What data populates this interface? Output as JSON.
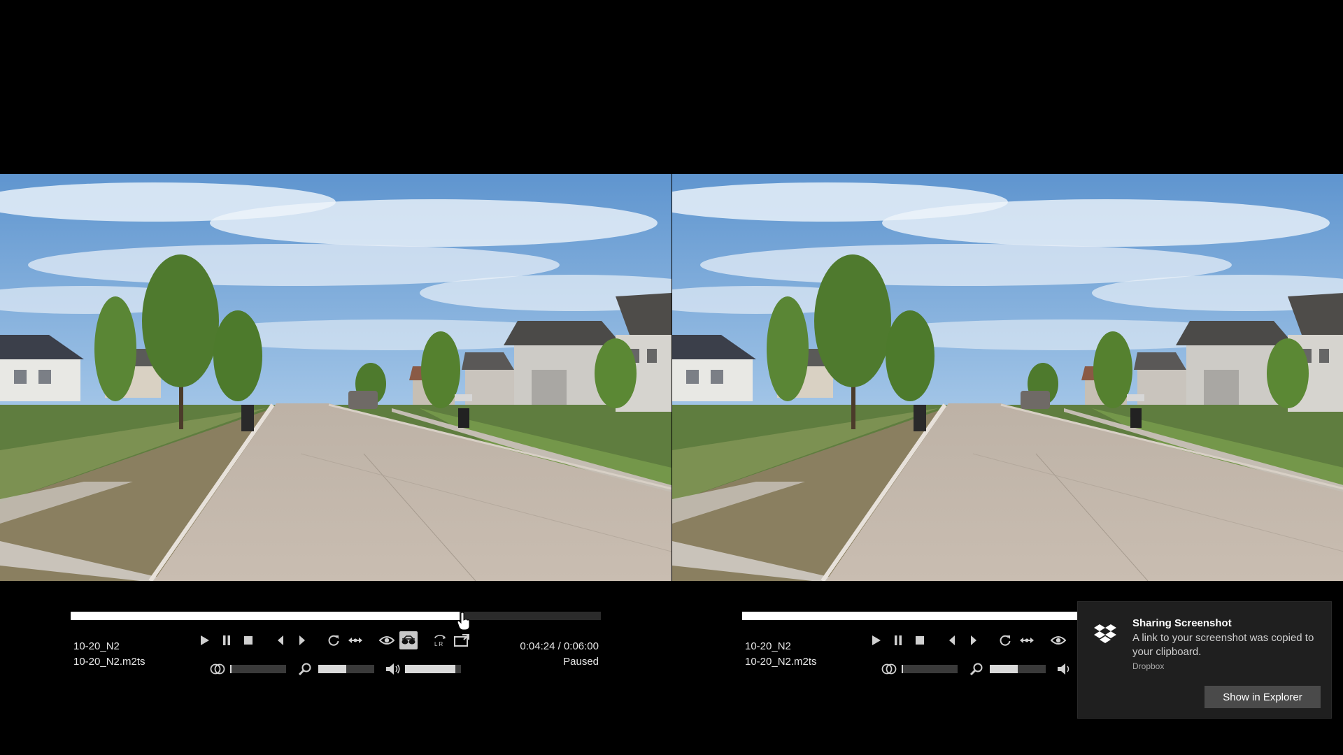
{
  "players": [
    {
      "file_name": "10-20_N2",
      "file_path": "10-20_N2.m2ts",
      "time": "0:04:24 / 0:06:00",
      "status": "Paused",
      "progress": 0.733
    },
    {
      "file_name": "10-20_N2",
      "file_path": "10-20_N2.m2ts",
      "progress": 0.733
    }
  ],
  "sliders": {
    "stereo_depth": 0.02,
    "zoom": 0.5,
    "volume": 0.9
  },
  "icons": {
    "play": "play-icon",
    "pause": "pause-icon",
    "stop": "stop-icon",
    "prev": "previous-icon",
    "next": "next-icon",
    "loop": "loop-icon",
    "swap": "swap-icon",
    "view": "eye-icon",
    "glasses": "3d-glasses-icon",
    "lr": "left-right-icon",
    "fullscreen": "exit-fullscreen-icon",
    "depth": "stereo-depth-icon",
    "zoom": "zoom-icon",
    "volume": "volume-icon"
  },
  "notification": {
    "title": "Sharing Screenshot",
    "body": "A link to your screenshot was copied to your clipboard.",
    "source": "Dropbox",
    "button": "Show in Explorer"
  },
  "colors": {
    "background": "#000000",
    "seek_fill": "#ffffff",
    "toast_bg": "#1f1f1f",
    "toast_button": "#4a4a4a"
  }
}
